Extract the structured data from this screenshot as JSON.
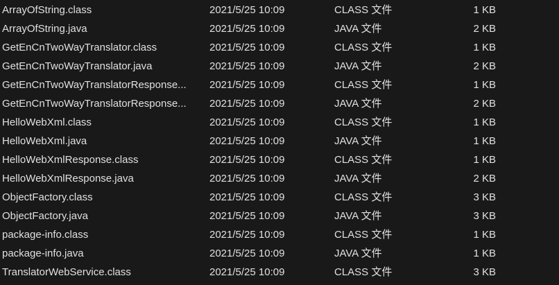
{
  "files": [
    {
      "name": "ArrayOfString.class",
      "modified": "2021/5/25 10:09",
      "type": "CLASS 文件",
      "size": "1 KB"
    },
    {
      "name": "ArrayOfString.java",
      "modified": "2021/5/25 10:09",
      "type": "JAVA 文件",
      "size": "2 KB"
    },
    {
      "name": "GetEnCnTwoWayTranslator.class",
      "modified": "2021/5/25 10:09",
      "type": "CLASS 文件",
      "size": "1 KB"
    },
    {
      "name": "GetEnCnTwoWayTranslator.java",
      "modified": "2021/5/25 10:09",
      "type": "JAVA 文件",
      "size": "2 KB"
    },
    {
      "name": "GetEnCnTwoWayTranslatorResponse...",
      "modified": "2021/5/25 10:09",
      "type": "CLASS 文件",
      "size": "1 KB"
    },
    {
      "name": "GetEnCnTwoWayTranslatorResponse...",
      "modified": "2021/5/25 10:09",
      "type": "JAVA 文件",
      "size": "2 KB"
    },
    {
      "name": "HelloWebXml.class",
      "modified": "2021/5/25 10:09",
      "type": "CLASS 文件",
      "size": "1 KB"
    },
    {
      "name": "HelloWebXml.java",
      "modified": "2021/5/25 10:09",
      "type": "JAVA 文件",
      "size": "1 KB"
    },
    {
      "name": "HelloWebXmlResponse.class",
      "modified": "2021/5/25 10:09",
      "type": "CLASS 文件",
      "size": "1 KB"
    },
    {
      "name": "HelloWebXmlResponse.java",
      "modified": "2021/5/25 10:09",
      "type": "JAVA 文件",
      "size": "2 KB"
    },
    {
      "name": "ObjectFactory.class",
      "modified": "2021/5/25 10:09",
      "type": "CLASS 文件",
      "size": "3 KB"
    },
    {
      "name": "ObjectFactory.java",
      "modified": "2021/5/25 10:09",
      "type": "JAVA 文件",
      "size": "3 KB"
    },
    {
      "name": "package-info.class",
      "modified": "2021/5/25 10:09",
      "type": "CLASS 文件",
      "size": "1 KB"
    },
    {
      "name": "package-info.java",
      "modified": "2021/5/25 10:09",
      "type": "JAVA 文件",
      "size": "1 KB"
    },
    {
      "name": "TranslatorWebService.class",
      "modified": "2021/5/25 10:09",
      "type": "CLASS 文件",
      "size": "3 KB"
    }
  ]
}
